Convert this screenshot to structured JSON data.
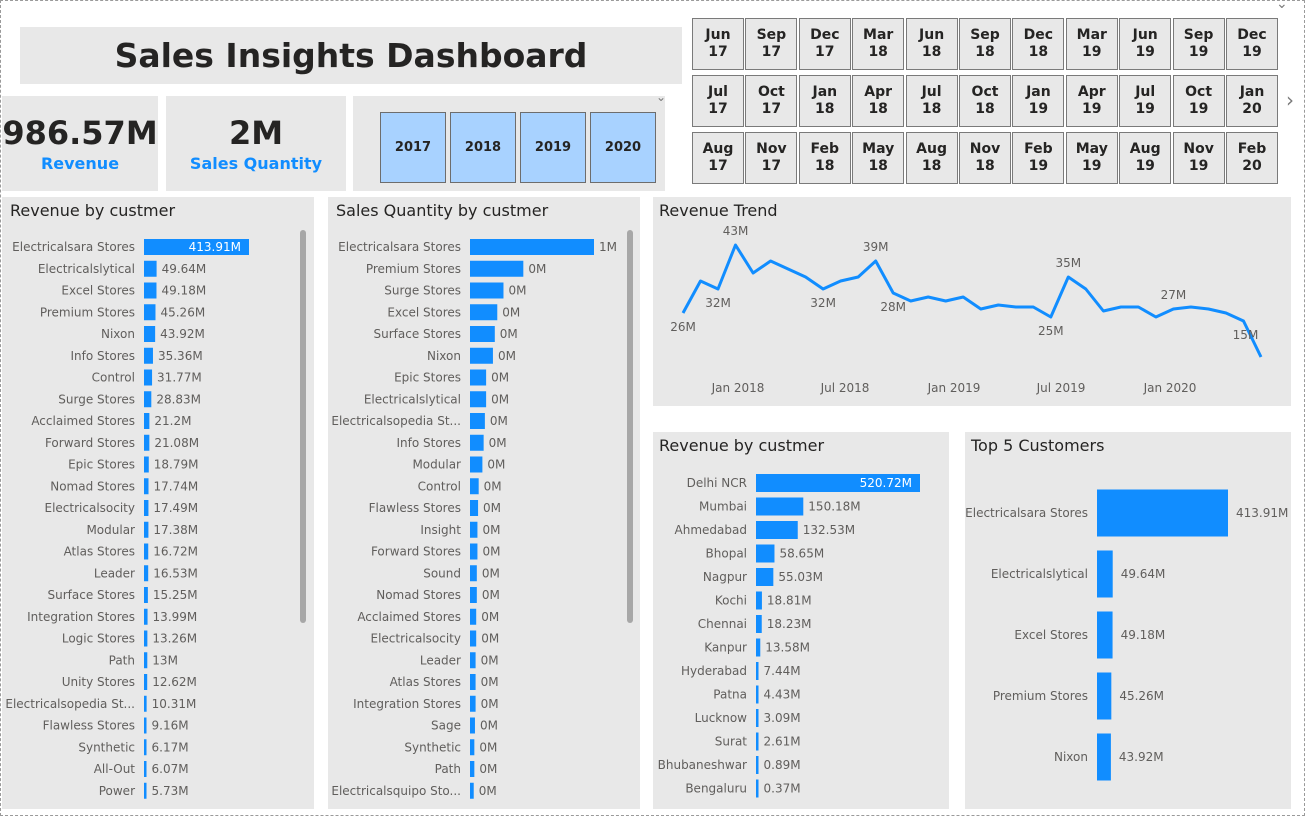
{
  "title": "Sales Insights Dashboard",
  "kpis": {
    "revenue": {
      "value": "986.57M",
      "label": "Revenue"
    },
    "quantity": {
      "value": "2M",
      "label": "Sales Quantity"
    }
  },
  "colors": {
    "accent": "#118DFF",
    "panel": "#e8e8e8",
    "year_selected": "#a8d2ff"
  },
  "year_slicer": [
    "2017",
    "2018",
    "2019",
    "2020"
  ],
  "month_slicer": [
    [
      "Jun",
      "17"
    ],
    [
      "Sep",
      "17"
    ],
    [
      "Dec",
      "17"
    ],
    [
      "Mar",
      "18"
    ],
    [
      "Jun",
      "18"
    ],
    [
      "Sep",
      "18"
    ],
    [
      "Dec",
      "18"
    ],
    [
      "Mar",
      "19"
    ],
    [
      "Jun",
      "19"
    ],
    [
      "Sep",
      "19"
    ],
    [
      "Dec",
      "19"
    ],
    [
      "Jul",
      "17"
    ],
    [
      "Oct",
      "17"
    ],
    [
      "Jan",
      "18"
    ],
    [
      "Apr",
      "18"
    ],
    [
      "Jul",
      "18"
    ],
    [
      "Oct",
      "18"
    ],
    [
      "Jan",
      "19"
    ],
    [
      "Apr",
      "19"
    ],
    [
      "Jul",
      "19"
    ],
    [
      "Oct",
      "19"
    ],
    [
      "Jan",
      "20"
    ],
    [
      "Aug",
      "17"
    ],
    [
      "Nov",
      "17"
    ],
    [
      "Feb",
      "18"
    ],
    [
      "May",
      "18"
    ],
    [
      "Aug",
      "18"
    ],
    [
      "Nov",
      "18"
    ],
    [
      "Feb",
      "19"
    ],
    [
      "May",
      "19"
    ],
    [
      "Aug",
      "19"
    ],
    [
      "Nov",
      "19"
    ],
    [
      "Feb",
      "20"
    ]
  ],
  "chart_data": [
    {
      "type": "bar",
      "title": "Revenue by custmer",
      "categories": [
        "Electricalsara Stores",
        "Electricalslytical",
        "Excel Stores",
        "Premium Stores",
        "Nixon",
        "Info Stores",
        "Control",
        "Surge Stores",
        "Acclaimed Stores",
        "Forward Stores",
        "Epic Stores",
        "Nomad Stores",
        "Electricalsocity",
        "Modular",
        "Atlas Stores",
        "Leader",
        "Surface Stores",
        "Integration Stores",
        "Logic Stores",
        "Path",
        "Unity Stores",
        "Electricalsopedia St...",
        "Flawless Stores",
        "Synthetic",
        "All-Out",
        "Power"
      ],
      "values": [
        413.91,
        49.64,
        49.18,
        45.26,
        43.92,
        35.36,
        31.77,
        28.83,
        21.2,
        21.08,
        18.79,
        17.74,
        17.49,
        17.38,
        16.72,
        16.53,
        15.25,
        13.99,
        13.26,
        13,
        12.62,
        10.31,
        9.16,
        6.17,
        6.07,
        5.73
      ],
      "labels": [
        "413.91M",
        "49.64M",
        "49.18M",
        "45.26M",
        "43.92M",
        "35.36M",
        "31.77M",
        "28.83M",
        "21.2M",
        "21.08M",
        "18.79M",
        "17.74M",
        "17.49M",
        "17.38M",
        "16.72M",
        "16.53M",
        "15.25M",
        "13.99M",
        "13.26M",
        "13M",
        "12.62M",
        "10.31M",
        "9.16M",
        "6.17M",
        "6.07M",
        "5.73M"
      ]
    },
    {
      "type": "bar",
      "title": "Sales Quantity by custmer",
      "categories": [
        "Electricalsara Stores",
        "Premium Stores",
        "Surge Stores",
        "Excel Stores",
        "Surface Stores",
        "Nixon",
        "Epic Stores",
        "Electricalslytical",
        "Electricalsopedia St...",
        "Info Stores",
        "Modular",
        "Control",
        "Flawless Stores",
        "Insight",
        "Forward Stores",
        "Sound",
        "Nomad Stores",
        "Acclaimed Stores",
        "Electricalsocity",
        "Leader",
        "Atlas Stores",
        "Integration Stores",
        "Sage",
        "Synthetic",
        "Path",
        "Electricalsquipo Sto..."
      ],
      "values": [
        1000,
        430,
        270,
        220,
        200,
        185,
        130,
        130,
        120,
        110,
        100,
        70,
        65,
        60,
        60,
        55,
        55,
        50,
        50,
        45,
        45,
        45,
        40,
        35,
        35,
        30
      ],
      "labels": [
        "1M",
        "0M",
        "0M",
        "0M",
        "0M",
        "0M",
        "0M",
        "0M",
        "0M",
        "0M",
        "0M",
        "0M",
        "0M",
        "0M",
        "0M",
        "0M",
        "0M",
        "0M",
        "0M",
        "0M",
        "0M",
        "0M",
        "0M",
        "0M",
        "0M",
        "0M"
      ]
    },
    {
      "type": "line",
      "title": "Revenue Trend",
      "x_ticks": [
        "Jan 2018",
        "Jul 2018",
        "Jan 2019",
        "Jul 2019",
        "Jan 2020"
      ],
      "x": [
        "Oct 2017",
        "Nov 2017",
        "Dec 2017",
        "Jan 2018",
        "Feb 2018",
        "Mar 2018",
        "Apr 2018",
        "May 2018",
        "Jun 2018",
        "Jul 2018",
        "Aug 2018",
        "Sep 2018",
        "Oct 2018",
        "Nov 2018",
        "Dec 2018",
        "Jan 2019",
        "Feb 2019",
        "Mar 2019",
        "Apr 2019",
        "May 2019",
        "Jun 2019",
        "Jul 2019",
        "Aug 2019",
        "Sep 2019",
        "Oct 2019",
        "Nov 2019",
        "Dec 2019",
        "Jan 2020",
        "Feb 2020",
        "Mar 2020",
        "Apr 2020",
        "May 2020",
        "Jun 2020"
      ],
      "values": [
        26,
        34,
        32,
        43,
        36,
        39,
        37,
        35,
        32,
        34,
        35,
        39,
        31,
        29,
        30,
        29,
        30,
        27,
        28,
        27.5,
        27.5,
        25,
        35,
        32,
        26.5,
        27.5,
        27.5,
        25,
        27,
        27.5,
        27,
        26,
        24,
        15
      ],
      "point_labels": {
        "Oct 2017": "26M",
        "Dec 2017": "32M",
        "Jan 2018": "43M",
        "Jun 2018": "32M",
        "Sep 2018": "39M",
        "Oct 2018": "28M",
        "Jul 2019": "25M",
        "Aug 2019": "35M",
        "Feb 2020": "27M",
        "Jun 2020": "15M"
      }
    },
    {
      "type": "bar",
      "title": "Revenue by custmer",
      "categories": [
        "Delhi NCR",
        "Mumbai",
        "Ahmedabad",
        "Bhopal",
        "Nagpur",
        "Kochi",
        "Chennai",
        "Kanpur",
        "Hyderabad",
        "Patna",
        "Lucknow",
        "Surat",
        "Bhubaneshwar",
        "Bengaluru"
      ],
      "values": [
        520.72,
        150.18,
        132.53,
        58.65,
        55.03,
        18.81,
        18.23,
        13.58,
        7.44,
        4.43,
        3.09,
        2.61,
        0.89,
        0.37
      ],
      "labels": [
        "520.72M",
        "150.18M",
        "132.53M",
        "58.65M",
        "55.03M",
        "18.81M",
        "18.23M",
        "13.58M",
        "7.44M",
        "4.43M",
        "3.09M",
        "2.61M",
        "0.89M",
        "0.37M"
      ]
    },
    {
      "type": "bar",
      "title": "Top 5 Customers",
      "categories": [
        "Electricalsara Stores",
        "Electricalslytical",
        "Excel Stores",
        "Premium Stores",
        "Nixon"
      ],
      "values": [
        413.91,
        49.64,
        49.18,
        45.26,
        43.92
      ],
      "labels": [
        "413.91M",
        "49.64M",
        "49.18M",
        "45.26M",
        "43.92M"
      ]
    }
  ]
}
